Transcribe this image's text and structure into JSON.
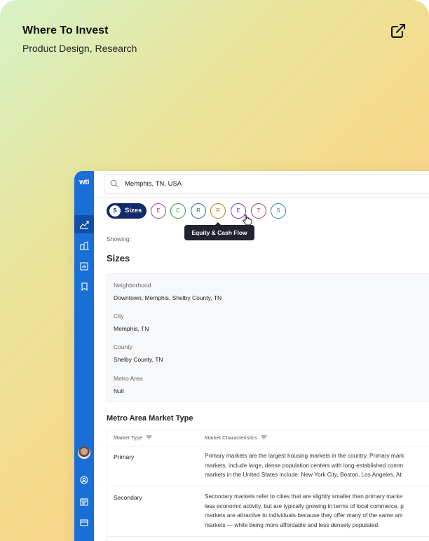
{
  "card": {
    "title": "Where To Invest",
    "subtitle": "Product Design, Research"
  },
  "app": {
    "logo": "wti",
    "search": {
      "value": "Memphis, TN, USA"
    },
    "chips": {
      "active": {
        "letter": "S",
        "label": "Sizes"
      },
      "items": [
        {
          "letter": "E",
          "color": "#b83280"
        },
        {
          "letter": "C",
          "color": "#3a9a3a"
        },
        {
          "letter": "R",
          "color": "#1a5fb4"
        },
        {
          "letter": "R",
          "color": "#c07a1a"
        },
        {
          "letter": "E",
          "color": "#5a3ab8"
        },
        {
          "letter": "T",
          "color": "#b83a5a"
        },
        {
          "letter": "S",
          "color": "#1a8a9a"
        }
      ]
    },
    "tooltip": "Equity & Cash Flow",
    "showing_label": "Showing:",
    "section_title": "Sizes",
    "fields": [
      {
        "label": "Neighborhood",
        "value": "Downtown, Memphis, Shelby County, TN"
      },
      {
        "label": "City",
        "value": "Memphis, TN"
      },
      {
        "label": "County",
        "value": "Shelby County, TN"
      },
      {
        "label": "Metro Area",
        "value": "Null"
      }
    ],
    "market": {
      "title": "Metro Area Market Type",
      "columns": [
        "Market Type",
        "Market Characteristics"
      ],
      "rows": [
        {
          "type": "Primary",
          "lines": [
            "Primary markets are the largest housing markets in the country. Primary mark",
            "markets, include large, dense population centers with long-established comm",
            "markets in the United States include: New York City, Boston, Los Angeles, At"
          ]
        },
        {
          "type": "Secondary",
          "lines": [
            "Secondary markets refer to cities that are slightly smaller than primary marke",
            "less economic activity, but are typically growing in terms of local commerce, p",
            "markets are attractive to individuals because they offer many of the same am",
            "markets — while being more affordable and less densely populated."
          ]
        }
      ]
    }
  }
}
